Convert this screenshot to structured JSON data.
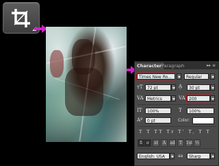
{
  "tabs": {
    "character": "Character",
    "paragraph": "Paragraph"
  },
  "panel_controls": "▸▸ ≡",
  "font": {
    "family": "Times New Ro...",
    "style": "Regular"
  },
  "size": {
    "font_size": "72 pt",
    "leading": "30 pt"
  },
  "kerning": {
    "kern": "Metrics",
    "tracking": "200"
  },
  "scale": {
    "vertical": "100%",
    "horizontal": "100%"
  },
  "baseline": {
    "shift": "0 pt",
    "color_label": "Color:"
  },
  "style_buttons": "T T TT Tr T' T, T T",
  "opentype_buttons": [
    "fi",
    "σ",
    "st",
    "A",
    "ad",
    "T",
    "1st",
    "½"
  ],
  "language": {
    "value": "English: USA",
    "antialias_icon": "aa",
    "antialias": "Sharp"
  },
  "colors": {
    "highlight": "#d0141e",
    "arrow": "#d020c8"
  }
}
